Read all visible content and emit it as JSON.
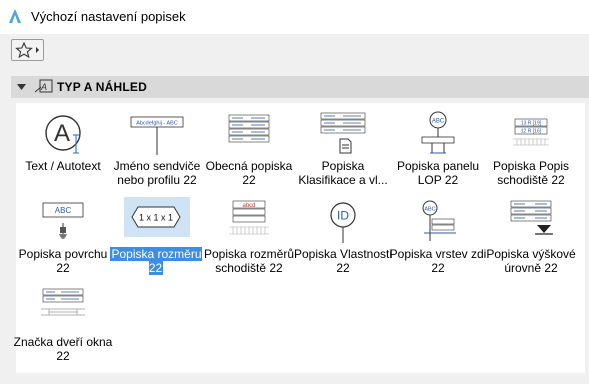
{
  "window": {
    "title": "Výchozí nastavení popisek"
  },
  "toolbar": {
    "favorites_icon": "star-icon"
  },
  "section": {
    "title": "TYP A NÁHLED",
    "icon": "label-type-icon"
  },
  "items": [
    {
      "label": "Text / Autotext",
      "icon": "autotext-icon",
      "selected": false
    },
    {
      "label": "Jméno sendviče nebo profilu 22",
      "icon": "composite-name-icon",
      "selected": false
    },
    {
      "label": "Obecná popiska 22",
      "icon": "general-label-icon",
      "selected": false
    },
    {
      "label": "Popiska Klasifikace a vl...",
      "icon": "classification-label-icon",
      "selected": false
    },
    {
      "label": "Popiska panelu LOP 22",
      "icon": "panel-label-icon",
      "selected": false
    },
    {
      "label": "Popiska Popis schodiště 22",
      "icon": "stair-description-icon",
      "selected": false
    },
    {
      "label": "Popiska povrchu 22",
      "icon": "surface-label-icon",
      "selected": false
    },
    {
      "label": "Popiska rozměru 22",
      "icon": "dimension-label-icon",
      "selected": true
    },
    {
      "label": "Popiska rozměrů schodiště 22",
      "icon": "stair-dimension-icon",
      "selected": false
    },
    {
      "label": "Popiska Vlastnosti 22",
      "icon": "properties-label-icon",
      "selected": false
    },
    {
      "label": "Popiska vrstev zdi 22",
      "icon": "wall-layers-icon",
      "selected": false
    },
    {
      "label": "Popiska výškové úrovně 22",
      "icon": "elevation-label-icon",
      "selected": false
    },
    {
      "label": "Značka dveří okna 22",
      "icon": "door-window-marker-icon",
      "selected": false
    }
  ],
  "thumb_text": {
    "profile": "Abcdefghij - ABC",
    "dimension": "1 x 1 x 1",
    "surface": "ABC",
    "properties": "ID",
    "panel": "ABC",
    "stair_dim": "abcd",
    "stair_desc_1": "13 R [19]",
    "stair_desc_2": "12 R [16]"
  }
}
